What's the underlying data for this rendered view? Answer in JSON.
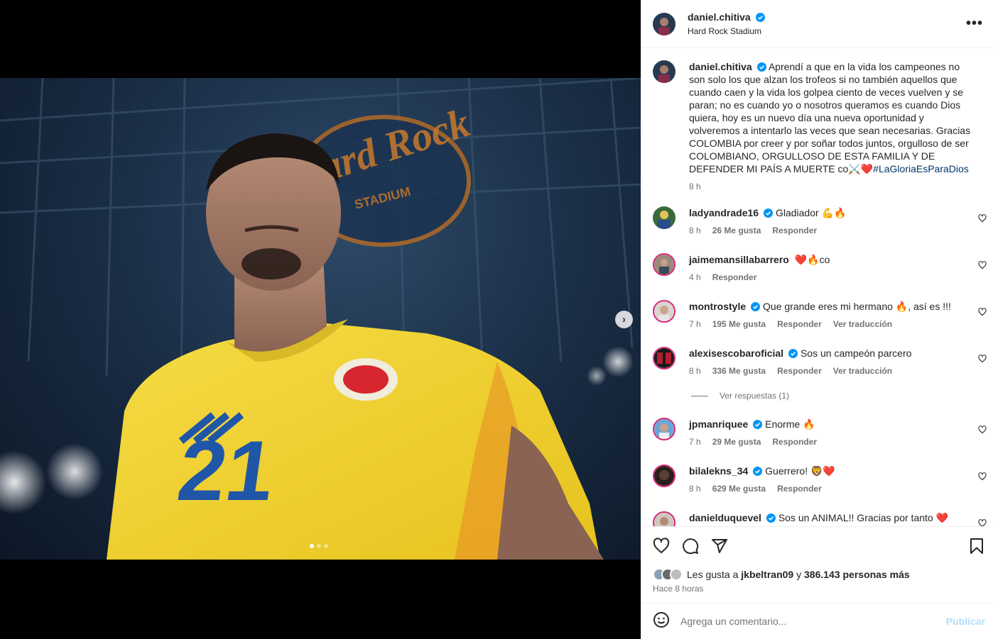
{
  "post": {
    "username": "daniel.chitiva",
    "location": "Hard Rock Stadium",
    "caption": "Aprendí a que en la vida los campeones no son solo los que alzan los trofeos si no también aquellos que cuando caen y la vida los golpea ciento de veces vuelven y se paran; no es cuando yo o nosotros queramos es cuando Dios quiera, hoy es un nuevo día una nueva oportunidad y volveremos a intentarlo las veces que sean necesarias. Gracias COLOMBIA por creer y por soñar todos juntos, orgulloso de ser COLOMBIANO, ORGULLOSO DE ESTA FAMILIA Y DE DEFENDER MI PAÍS A MUERTE co⚔️❤️",
    "hashtag": "#LaGloriaEsParaDios",
    "caption_time": "8 h",
    "photo": {
      "jersey_number": "21",
      "sign_text": "Hard Rock",
      "sign_subtext": "STADIUM"
    },
    "carousel": {
      "count": 3,
      "active": 0
    }
  },
  "comments": [
    {
      "user": "ladyandrade16",
      "verified": true,
      "text": "Gladiador 💪🔥",
      "time": "8 h",
      "likes": "26 Me gusta",
      "reply": "Responder",
      "translate": ""
    },
    {
      "user": "jaimemansillabarrero",
      "verified": false,
      "text": "❤️🔥co",
      "time": "4 h",
      "likes": "",
      "reply": "Responder",
      "translate": ""
    },
    {
      "user": "montrostyle",
      "verified": true,
      "text": "Que grande eres mi hermano 🔥, así es !!!",
      "time": "7 h",
      "likes": "195 Me gusta",
      "reply": "Responder",
      "translate": "Ver traducción"
    },
    {
      "user": "alexisescobaroficial",
      "verified": true,
      "text": "Sos un campeón parcero",
      "time": "8 h",
      "likes": "336 Me gusta",
      "reply": "Responder",
      "translate": "Ver traducción"
    },
    {
      "user": "jpmanriquee",
      "verified": true,
      "text": "Enorme 🔥",
      "time": "7 h",
      "likes": "29 Me gusta",
      "reply": "Responder",
      "translate": ""
    },
    {
      "user": "bilalekns_34",
      "verified": true,
      "text": "Guerrero! 🦁❤️",
      "time": "8 h",
      "likes": "629 Me gusta",
      "reply": "Responder",
      "translate": ""
    },
    {
      "user": "danielduquevel",
      "verified": true,
      "text": "Sos un ANIMAL!! Gracias por tanto ❤️",
      "time": "",
      "likes": "",
      "reply": "",
      "translate": ""
    }
  ],
  "view_replies": "Ver respuestas (1)",
  "likes": {
    "prefix": "Les gusta a",
    "first_user": "jkbeltran09",
    "joiner": "y",
    "others": "386.143 personas más"
  },
  "posted_ago": "Hace 8 horas",
  "composer": {
    "placeholder": "Agrega un comentario...",
    "publish_label": "Publicar"
  },
  "colors": {
    "verified": "#0095f6",
    "link": "#00376b",
    "muted": "#737373",
    "publish_disabled": "#b2dffc",
    "jersey": "#f2d230",
    "jersey_number": "#1f56a8"
  },
  "icons": [
    "more-options-icon",
    "heart-icon",
    "comment-icon",
    "share-icon",
    "bookmark-icon",
    "emoji-icon",
    "verified-icon",
    "chevron-right-icon"
  ]
}
